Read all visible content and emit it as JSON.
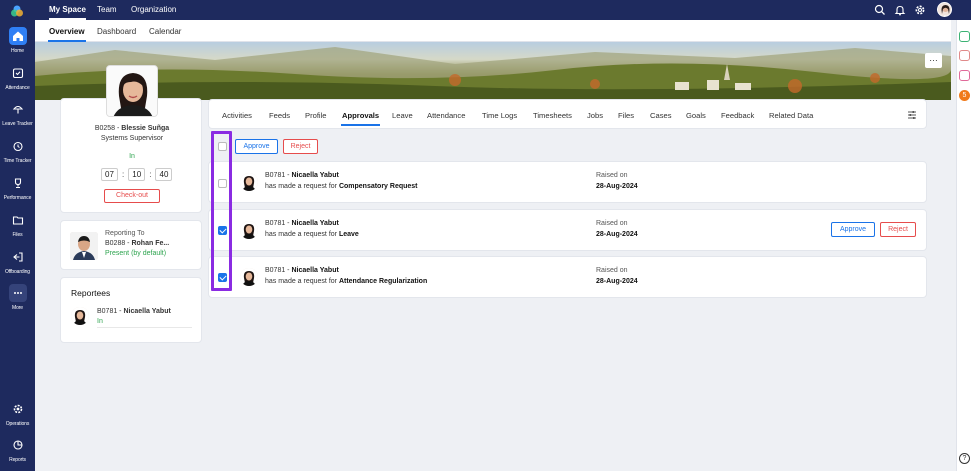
{
  "left_nav": {
    "items": [
      {
        "label": "Home",
        "icon": "home-icon",
        "active": true
      },
      {
        "label": "Attendance",
        "icon": "attendance-icon"
      },
      {
        "label": "Leave Tracker",
        "icon": "leave-tracker-icon"
      },
      {
        "label": "Time Tracker",
        "icon": "time-tracker-icon"
      },
      {
        "label": "Performance",
        "icon": "trophy-icon"
      },
      {
        "label": "Files",
        "icon": "files-icon"
      },
      {
        "label": "Offboarding",
        "icon": "offboarding-icon"
      },
      {
        "label": "More",
        "icon": "more-icon"
      }
    ],
    "bottom_items": [
      {
        "label": "Operations",
        "icon": "gear-icon"
      },
      {
        "label": "Reports",
        "icon": "reports-icon"
      }
    ]
  },
  "top_bar": {
    "tabs": [
      "My Space",
      "Team",
      "Organization"
    ],
    "active_tab": "My Space"
  },
  "sub_bar": {
    "tabs": [
      "Overview",
      "Dashboard",
      "Calendar"
    ],
    "active_tab": "Overview"
  },
  "profile": {
    "emp_id": "B0258 - ",
    "name": "Blessie Suñga",
    "title": "Systems Supervisor",
    "status": "In",
    "timer": {
      "h": "07",
      "m": "10",
      "s": "40"
    },
    "checkout_label": "Check-out"
  },
  "reporting": {
    "heading": "Reporting To",
    "emp_id": "B0288 - ",
    "name": "Rohan Fe...",
    "status": "Present (by default)"
  },
  "reportees": {
    "heading": "Reportees",
    "items": [
      {
        "emp_id": "B0781 - ",
        "name": "Nicaella Yabut",
        "status": "In"
      }
    ]
  },
  "main_tabs": [
    "Activities",
    "Feeds",
    "Profile",
    "Approvals",
    "Leave",
    "Attendance",
    "Time Logs",
    "Timesheets",
    "Jobs",
    "Files",
    "Cases",
    "Goals",
    "Feedback",
    "Related Data"
  ],
  "active_main_tab": "Approvals",
  "bulk_actions": {
    "approve": "Approve",
    "reject": "Reject"
  },
  "requests": [
    {
      "emp_id": "B0781 - ",
      "name": "Nicaella Yabut",
      "prefix": "has made a request for ",
      "type": "Compensatory Request",
      "raised_label": "Raised on",
      "date": "28-Aug-2024",
      "checked": false,
      "show_actions": false
    },
    {
      "emp_id": "B0781 - ",
      "name": "Nicaella Yabut",
      "prefix": "has made a request for ",
      "type": "Leave",
      "raised_label": "Raised on",
      "date": "28-Aug-2024",
      "checked": true,
      "show_actions": true,
      "approve": "Approve",
      "reject": "Reject"
    },
    {
      "emp_id": "B0781 - ",
      "name": "Nicaella Yabut",
      "prefix": "has made a request for ",
      "type": "Attendance Regularization",
      "raised_label": "Raised on",
      "date": "28-Aug-2024",
      "checked": true,
      "show_actions": false
    }
  ],
  "right_rail": {
    "badge_count": "5"
  },
  "banner": {
    "more_label": "…"
  },
  "colors": {
    "nav": "#1e2a5e",
    "accent": "#1a73e8",
    "reject": "#e64c4c",
    "present": "#2ea44f",
    "highlight": "#8a2be2"
  }
}
